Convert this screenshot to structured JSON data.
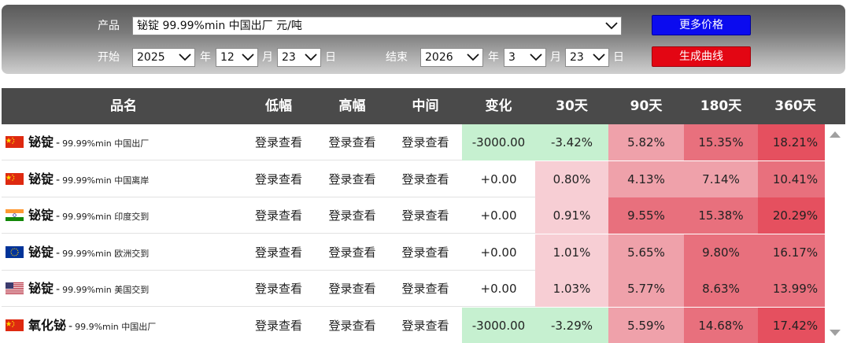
{
  "filter": {
    "product_label": "产品",
    "product_value": "铋锭 99.99%min 中国出厂 元/吨",
    "start_label": "开始",
    "start_year": "2025",
    "start_month": "12",
    "start_day": "23",
    "end_label": "结束",
    "end_year": "2026",
    "end_month": "3",
    "end_day": "23",
    "year_unit": "年",
    "month_unit": "月",
    "day_unit": "日",
    "more_prices_label": "更多价格",
    "generate_chart_label": "生成曲线"
  },
  "colors": {
    "blue_button": "#0b0bef",
    "red_button": "#e30613",
    "header_bg": "#4a4a4a",
    "change_negative": "#c6f0d0",
    "change_low": "#f7ced4",
    "change_mid": "#efa1aa",
    "change_high": "#e8707d",
    "change_max": "#e5505f"
  },
  "table": {
    "headers": {
      "name": "品名",
      "low": "低幅",
      "high": "高幅",
      "mid": "中间",
      "change": "变化",
      "d30": "30天",
      "d90": "90天",
      "d180": "180天",
      "d360": "360天"
    },
    "rows": [
      {
        "flag": "china-flag",
        "name": "铋锭",
        "spec": "99.99%min 中国出厂",
        "low": "登录查看",
        "high": "登录查看",
        "mid": "登录查看",
        "change": "-3000.00",
        "d30": "-3.42%",
        "d90": "5.82%",
        "d180": "15.35%",
        "d360": "18.21%"
      },
      {
        "flag": "china-flag",
        "name": "铋锭",
        "spec": "99.99%min 中国离岸",
        "low": "登录查看",
        "high": "登录查看",
        "mid": "登录查看",
        "change": "+0.00",
        "d30": "0.80%",
        "d90": "4.13%",
        "d180": "7.14%",
        "d360": "10.41%"
      },
      {
        "flag": "india-flag",
        "name": "铋锭",
        "spec": "99.99%min 印度交到",
        "low": "登录查看",
        "high": "登录查看",
        "mid": "登录查看",
        "change": "+0.00",
        "d30": "0.91%",
        "d90": "9.55%",
        "d180": "15.38%",
        "d360": "20.29%"
      },
      {
        "flag": "eu-flag",
        "name": "铋锭",
        "spec": "99.99%min 欧洲交到",
        "low": "登录查看",
        "high": "登录查看",
        "mid": "登录查看",
        "change": "+0.00",
        "d30": "1.01%",
        "d90": "5.65%",
        "d180": "9.80%",
        "d360": "16.17%"
      },
      {
        "flag": "usa-flag",
        "name": "铋锭",
        "spec": "99.99%min 美国交到",
        "low": "登录查看",
        "high": "登录查看",
        "mid": "登录查看",
        "change": "+0.00",
        "d30": "1.03%",
        "d90": "5.77%",
        "d180": "8.63%",
        "d360": "13.99%"
      },
      {
        "flag": "china-flag",
        "name": "氧化铋",
        "spec": "99.9%min 中国出厂",
        "low": "登录查看",
        "high": "登录查看",
        "mid": "登录查看",
        "change": "-3000.00",
        "d30": "-3.29%",
        "d90": "5.59%",
        "d180": "14.68%",
        "d360": "17.42%"
      }
    ]
  }
}
